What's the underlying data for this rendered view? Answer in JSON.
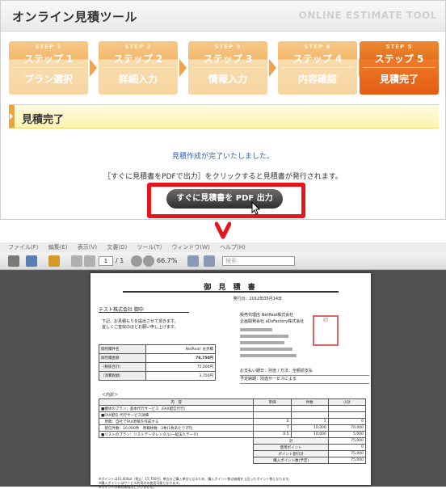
{
  "web": {
    "title": "オンライン見積ツール",
    "brand": "ONLINE ESTIMATE TOOL",
    "steps": [
      {
        "num": "STEP 1",
        "label": "ステップ 1",
        "title": "プラン選択",
        "active": false
      },
      {
        "num": "STEP 2",
        "label": "ステップ 2",
        "title": "詳細入力",
        "active": false
      },
      {
        "num": "STEP 3",
        "label": "ステップ 3",
        "title": "情報入力",
        "active": false
      },
      {
        "num": "STEP 4",
        "label": "ステップ 4",
        "title": "内容確認",
        "active": false
      },
      {
        "num": "STEP 5",
        "label": "ステップ 5",
        "title": "見積完了",
        "active": true
      }
    ],
    "section_title": "見積完了",
    "message1": "見積作成が完了いたしました。",
    "message2": "［すぐに見積書をPDFで出力］をクリックすると見積書が発行されます。",
    "pdf_button": "すぐに見積書を PDF 出力",
    "highlight_color": "#e8141b"
  },
  "viewer": {
    "menu": [
      "ファイル(F)",
      "編集(E)",
      "表示(V)",
      "文書(D)",
      "ツール(T)",
      "ウィンドウ(W)",
      "ヘルプ(H)"
    ],
    "page_current": "1",
    "page_total": "/ 1",
    "zoom": "66.7%",
    "search_placeholder": "検索"
  },
  "doc": {
    "title": "御 見 積 書",
    "date": "発行日：2012年05月14日",
    "customer": "テスト株式会社 御中",
    "lead": [
      "下記、お見積もりを提出させて頂きます。",
      "宜しくご査収のほどお願い申し上げます。"
    ],
    "seller": [
      "販売代理店 NetReal株式会社",
      "企画開発会社 aDsFactory株式会社"
    ],
    "stamp": "印",
    "summary": [
      {
        "k": "御見積件名",
        "v": "NetReal! お見積"
      },
      {
        "k": "御見積金額",
        "v": "78,750円"
      },
      {
        "k": "（税抜合計）",
        "v": "75,000円"
      },
      {
        "k": "（消費税額）",
        "v": "3,750円"
      }
    ],
    "terms": [
      "お支払い期日：別途 / 方法：全額前支払",
      "予定納期：別途サービスによる"
    ],
    "detail_label": "＜内訳＞",
    "headers": [
      "内　容",
      "単価",
      "件数",
      "小計"
    ],
    "rows": [
      {
        "item": "■機体のプラン：基本代行サービス（FAX配信代行）",
        "price": "",
        "qty": "",
        "sub": ""
      },
      {
        "item": "■FAX配信 代行サービス詳細",
        "price": "",
        "qty": "",
        "sub": ""
      },
      {
        "item": "　原稿：自社でFAX原稿を作成する",
        "price": "0",
        "qty": "1",
        "sub": "0"
      },
      {
        "item": "　配信件数：10,000件　原稿枚数：2枚(1枚あたり7円)",
        "price": "7",
        "qty": "10,000",
        "sub": "70,000"
      },
      {
        "item": "■リストのプラン：リストデータレンタル(一般法人データ)",
        "price": "0.5",
        "qty": "10,000",
        "sub": "5,000"
      }
    ],
    "totals": [
      {
        "label": "計",
        "value": "75,000"
      },
      {
        "label": "使用ポイント",
        "value": "0"
      },
      {
        "label": "ポイント割引計",
        "value": "75,000"
      },
      {
        "label": "購入ポイント数(予定)",
        "value": "75,000"
      }
    ],
    "notes": [
      "※ポイントは15,000pt（税込：15,750円）単位のご購入単位となるため、購入ポイント数は価格を上回ったポイント数となります。",
      "※購入ポイントはサービス利用のみ使用可能となります。",
      "※ポイントの有効期限はございません。"
    ]
  }
}
